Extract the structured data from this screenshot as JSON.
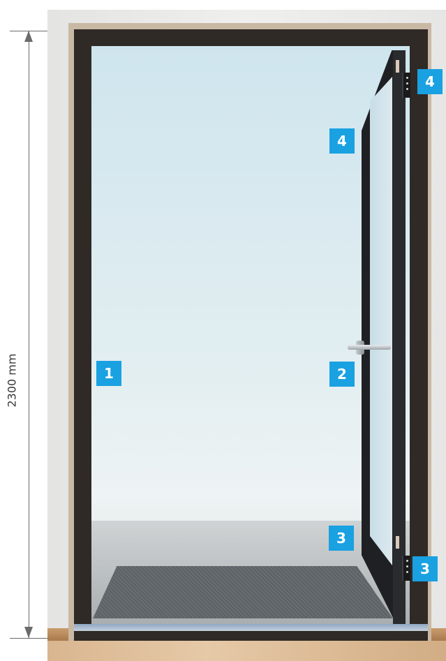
{
  "dimension": {
    "height_label": "2300 mm"
  },
  "markers": [
    {
      "number": "1",
      "part": "frame"
    },
    {
      "number": "2",
      "part": "door-leaf"
    },
    {
      "number": "3",
      "part": "door-leaf-bottom"
    },
    {
      "number": "3",
      "part": "frame-bottom"
    },
    {
      "number": "4",
      "part": "door-leaf-top"
    },
    {
      "number": "4",
      "part": "frame-top"
    }
  ],
  "colors": {
    "marker_blue": "#19a1e2",
    "frame_dark": "#2f2a26",
    "dimension_gray": "#6b6b6b"
  }
}
